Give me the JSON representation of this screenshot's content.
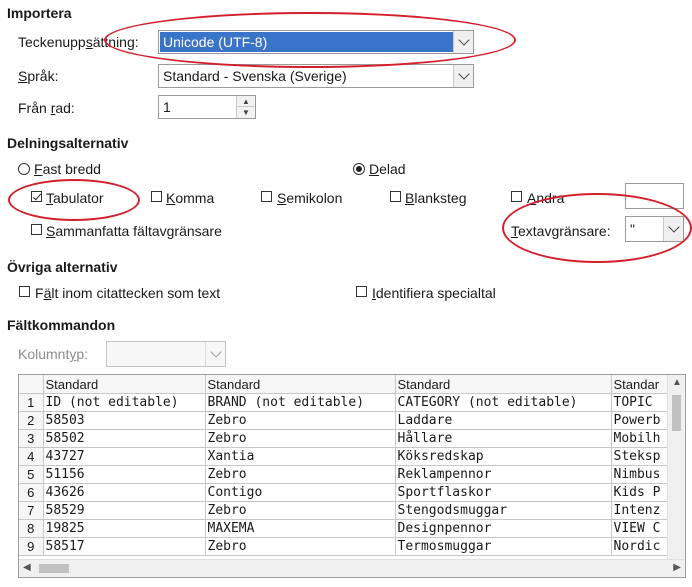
{
  "importera": {
    "heading": "Importera",
    "charset_label_pre": "Teckenupp",
    "charset_label_ul": "s",
    "charset_label_post": "ättning:",
    "charset_value": "Unicode (UTF-8)",
    "language_label_ul": "S",
    "language_label_post": "pråk:",
    "language_value": "Standard - Svenska (Sverige)",
    "from_row_label_pre": "Från ",
    "from_row_label_ul": "r",
    "from_row_label_post": "ad:",
    "from_row_value": "1"
  },
  "delning": {
    "heading": "Delningsalternativ",
    "fixed_pre": "",
    "fixed_ul": "F",
    "fixed_post": "ast bredd",
    "split_pre": "",
    "split_ul": "D",
    "split_post": "elad",
    "tab_pre": "",
    "tab_ul": "T",
    "tab_post": "abulator",
    "comma_pre": "",
    "comma_ul": "K",
    "comma_post": "omma",
    "semicolon_pre": "",
    "semicolon_ul": "S",
    "semicolon_post": "emikolon",
    "space_pre": "",
    "space_ul": "B",
    "space_post": "lanksteg",
    "other_pre": "",
    "other_ul": "A",
    "other_post": "ndra",
    "merge_pre": "",
    "merge_ul": "S",
    "merge_post": "ammanfatta fältavgränsare",
    "text_delim_pre": "",
    "text_delim_ul": "T",
    "text_delim_post": "extavgränsare:",
    "text_delim_value": "\""
  },
  "ovriga": {
    "heading": "Övriga alternativ",
    "quoted_pre": "F",
    "quoted_ul": "ä",
    "quoted_post": "lt inom citattecken som text",
    "special_pre": "",
    "special_ul": "I",
    "special_post": "dentifiera specialtal"
  },
  "faltkommandon": {
    "heading": "Fältkommandon",
    "column_type_label_pre": "Kolumnt",
    "column_type_label_ul": "y",
    "column_type_label_post": "p:"
  },
  "preview": {
    "headers": [
      "",
      "Standard",
      "Standard",
      "Standard",
      "Standar"
    ],
    "rows": [
      [
        "1",
        "ID (not editable)",
        "BRAND (not editable)",
        "CATEGORY (not editable)",
        "TOPIC"
      ],
      [
        "2",
        "58503",
        "Zebro",
        "Laddare",
        "Powerb"
      ],
      [
        "3",
        "58502",
        "Zebro",
        "Hållare",
        "Mobilh"
      ],
      [
        "4",
        "43727",
        "Xantia",
        "Köksredskap",
        "Steksp"
      ],
      [
        "5",
        "51156",
        "Zebro",
        "Reklampennor",
        "Nimbus"
      ],
      [
        "6",
        "43626",
        "Contigo",
        "Sportflaskor",
        "Kids P"
      ],
      [
        "7",
        "58529",
        "Zebro",
        "Stengodsmuggar",
        "Intenz"
      ],
      [
        "8",
        "19825",
        "MAXEMA",
        "Designpennor",
        "VIEW C"
      ],
      [
        "9",
        "58517",
        "Zebro",
        "Termosmuggar",
        "Nordic"
      ]
    ]
  },
  "colors": {
    "highlight": "#3a74c9",
    "annotation_ring": "#d31f2b"
  }
}
